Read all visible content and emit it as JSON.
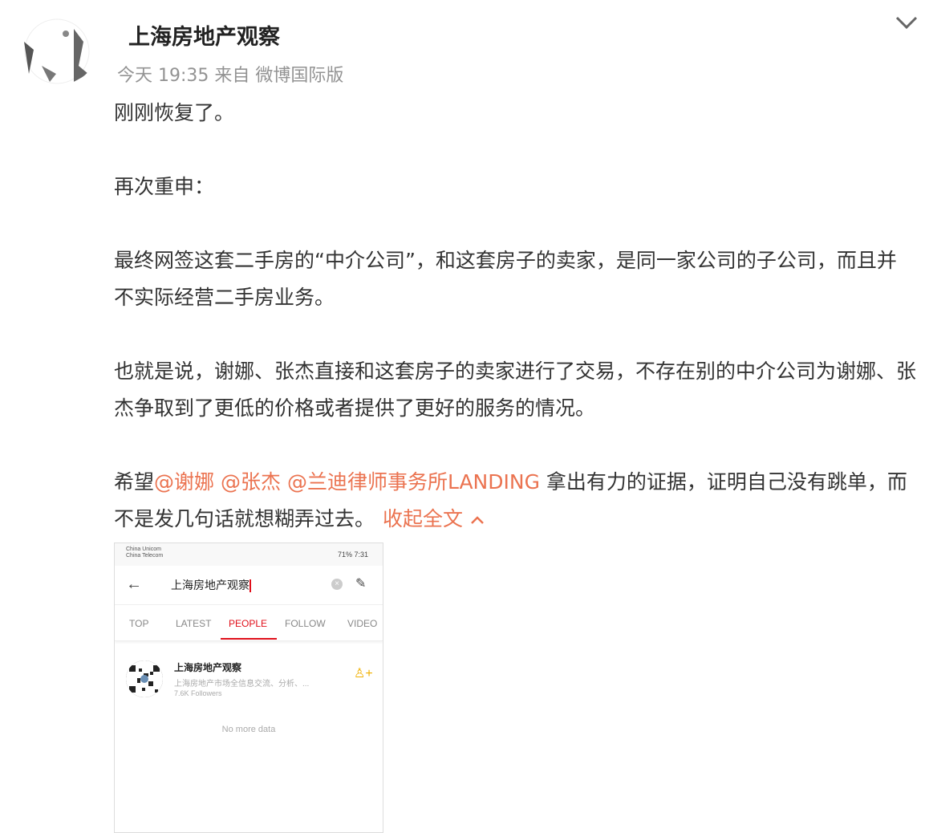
{
  "post": {
    "username": "上海房地产观察",
    "meta": "今天 19:35 来自 微博国际版",
    "paragraphs": {
      "p1": "刚刚恢复了。",
      "p2": "再次重申：",
      "p3": "最终网签这套二手房的“中介公司”，和这套房子的卖家，是同一家公司的子公司，而且并不实际经营二手房业务。",
      "p4": "也就是说，谢娜、张杰直接和这套房子的卖家进行了交易，不存在别的中介公司为谢娜、张杰争取到了更低的价格或者提供了更好的服务的情况。",
      "p5_prefix": "希望",
      "mention1": "@谢娜",
      "mention2": "@张杰",
      "mention3": "@兰迪律师事务所LANDING",
      "p5_suffix": " 拿出有力的证据，证明自己没有跳单，而不是发几句话就想糊弄过去。",
      "fold_label": "收起全文"
    },
    "link_color": "#eb7350"
  },
  "screenshot": {
    "status_carrier1": "China Unicom",
    "status_carrier2": "China Telecom",
    "status_right": "71% 7:31",
    "query": "上海房地产观察",
    "tabs": [
      "TOP",
      "LATEST",
      "PEOPLE",
      "FOLLOW",
      "VIDEO"
    ],
    "active_tab": "PEOPLE",
    "result_name": "上海房地产观察",
    "result_desc": "上海房地产市场全信息交流、分析、...",
    "result_followers": "7.6K Followers",
    "no_more": "No more data",
    "accent": "#e0101b"
  }
}
